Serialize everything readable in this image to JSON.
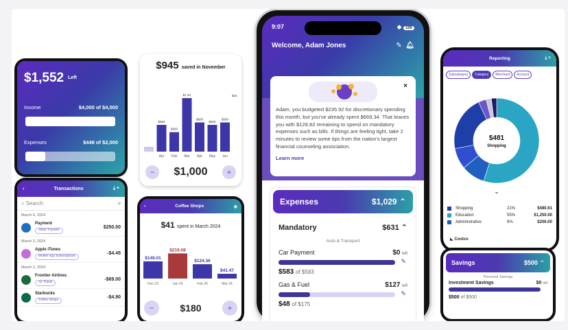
{
  "balance": {
    "amount": "$1,552",
    "left_label": "Left",
    "income_label": "Income",
    "income_value": "$4,000 of $4,000",
    "income_progress": 1.0,
    "expenses_label": "Expenses",
    "expenses_value": "$448 of $2,000",
    "expenses_progress": 0.224
  },
  "transactions": {
    "title": "Transactions",
    "search_placeholder": "Search",
    "groups": [
      {
        "date": "March 4, 2024",
        "name": "Payment",
        "tag": "Other Transfer",
        "amount": "$250.00",
        "icon_color": "#1f6fbf",
        "icon": "bank-icon"
      },
      {
        "date": "March 3, 2024",
        "name": "Apple iTunes",
        "tag": "Mobile App Subscriptions",
        "amount": "-$4.45",
        "icon_color": "#c66bd9",
        "icon": "music-icon"
      },
      {
        "date": "March 2, 2024",
        "name": "Frontier Airlines",
        "tag": "Air Travel",
        "amount": "-$69.00",
        "icon_color": "#1b6a3a",
        "icon": "airline-icon"
      },
      {
        "date": "",
        "name": "Starbucks",
        "tag": "Coffee Shops",
        "amount": "-$4.90",
        "icon_color": "#0b6b46",
        "icon": "coffee-icon"
      }
    ]
  },
  "savings_chart": {
    "amount": "$945",
    "saved_in": "saved in",
    "month": "November",
    "selected_value": "$1,000",
    "minus": "−",
    "plus": "+"
  },
  "chart_data": [
    {
      "type": "bar",
      "categories": [
        "",
        "Apr",
        "Feb",
        "Mar",
        "Apr",
        "May",
        "Jun"
      ],
      "values": [
        0.1,
        0.55,
        0.4,
        1.1,
        0.6,
        0.55,
        0.6
      ],
      "labels": [
        "",
        "$560",
        "$400",
        "$1.1K",
        "$600",
        "$600",
        "$560"
      ],
      "extra_label": "$1K"
    },
    {
      "type": "bar",
      "categories": [
        "Dec 23",
        "Jan 24",
        "Feb 24",
        "Mar 24"
      ],
      "values": [
        149.01,
        218.08,
        124.36,
        41.47
      ],
      "labels": [
        "$149.01",
        "$218.08",
        "$124.36",
        "$41.47"
      ]
    },
    {
      "type": "pie",
      "categories": [
        "Shopping",
        "Education",
        "Administrative"
      ],
      "percent": [
        "21%",
        "55%",
        "9%"
      ],
      "values": [
        "$480.61",
        "$1,250.00",
        "$206.00"
      ]
    }
  ],
  "coffee": {
    "title": "Coffee Shops",
    "amount": "$41",
    "caption": "spent in March 2024",
    "selected_value": "$180",
    "minus": "−",
    "plus": "+"
  },
  "phone": {
    "time": "9:07",
    "battery": "100",
    "welcome": "Welcome, Adam Jones",
    "message": "Adam, you budgeted $235.92 for discretionary spending this month, but you've already spent $669.34. That leaves you with $128.82 remaining to spend on mandatory expenses such as bills. If things are feeling tight, take 2 minutes to review some tips from the nation's largest financial counseling association.",
    "learn_more": "Learn more",
    "close": "×",
    "expenses_label": "Expenses",
    "expenses_total": "$1,029",
    "mandatory_label": "Mandatory",
    "mandatory_total": "$631",
    "group_label": "Auto & Transport",
    "items": [
      {
        "name": "Car Payment",
        "left": "$0",
        "left_label": "left",
        "spent": "$583",
        "of": "of $583",
        "progress": 1.0
      },
      {
        "name": "Gas & Fuel",
        "left": "$127",
        "left_label": "left",
        "spent": "$48",
        "of": "of $175",
        "progress": 0.27
      }
    ]
  },
  "reporting": {
    "title": "Reporting",
    "chips": [
      "Subcategory",
      "Category",
      "Merchant",
      "Account"
    ],
    "active_chip": "Category",
    "center_value": "$481",
    "center_label": "Shopping",
    "costco": "Costco"
  },
  "savings_card": {
    "title": "Savings",
    "total": "$500",
    "group_label": "Personal Savings",
    "item_name": "Investment Savings",
    "left": "$0",
    "left_label": "left",
    "spent": "$500",
    "of": "of $500"
  }
}
